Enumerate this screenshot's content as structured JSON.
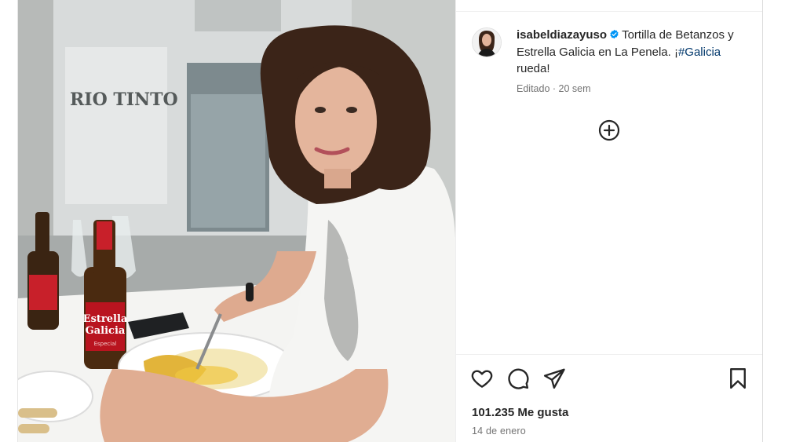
{
  "post": {
    "username": "isabeldiazayuso",
    "caption_text": "Tortilla de Betanzos y Estrella Galicia en La Penela. ¡",
    "hashtag": "#Galicia",
    "caption_end": " rueda!",
    "edited_label": "Editado",
    "time_ago": "20 sem",
    "likes": "101.235 Me gusta",
    "date": "14 de enero"
  },
  "photo": {
    "storefront_sign": "RIO TINTO",
    "bottle_brand_line1": "Estrella",
    "bottle_brand_line2": "Galicia",
    "bottle_label_small": "Especial"
  },
  "colors": {
    "verified_blue": "#0095f6",
    "hashtag": "#00376b",
    "meta_gray": "#737373"
  },
  "icons": [
    "verified-badge-icon",
    "add-circle-icon",
    "heart-icon",
    "comment-icon",
    "share-icon",
    "bookmark-icon"
  ]
}
